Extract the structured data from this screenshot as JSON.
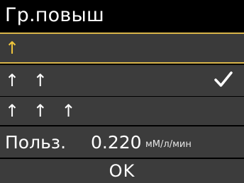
{
  "header": {
    "title": "Гр.повыш"
  },
  "options": [
    {
      "label": "↑"
    },
    {
      "label": "↑ ↑"
    },
    {
      "label": "↑ ↑ ↑"
    }
  ],
  "custom": {
    "label": "Польз.",
    "value": "0.220",
    "unit": "мМ/л/мин"
  },
  "footer": {
    "ok_label": "OK"
  },
  "colors": {
    "selection": "#d9b54a",
    "row_bg": "#3c3c3c",
    "background": "#000000"
  }
}
